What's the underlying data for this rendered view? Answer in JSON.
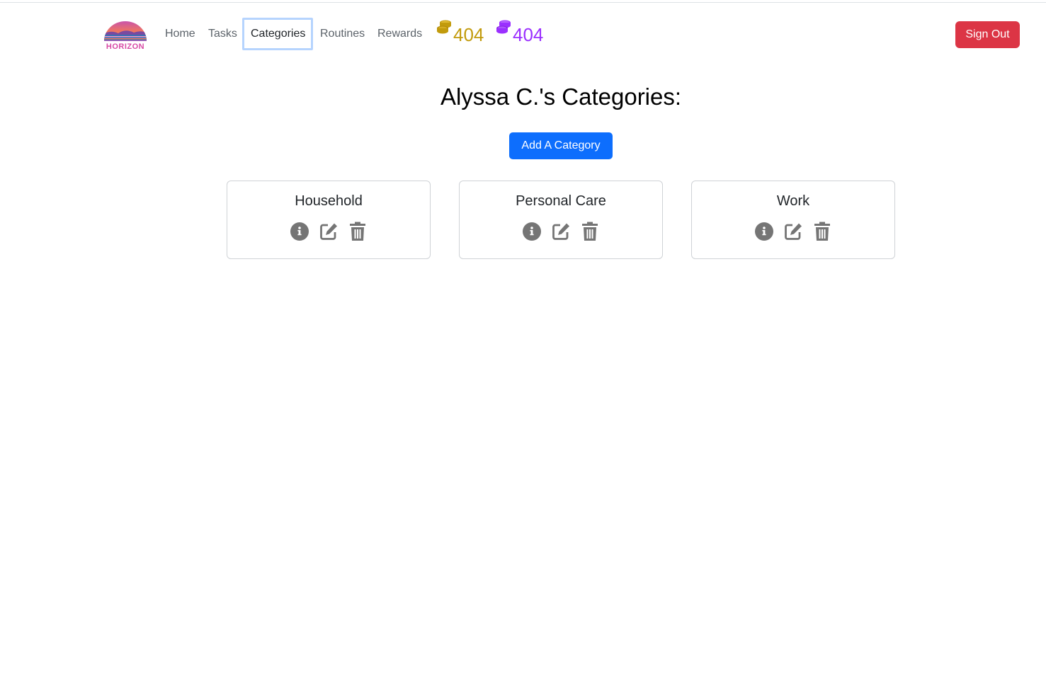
{
  "brand": {
    "logo_text": "HORIZON",
    "colors": {
      "sky_top": "#c44fb4",
      "sky_mid": "#f2785c",
      "sun": "#ffd27a",
      "sea": "#3a6fb0",
      "text": "#d84aa5"
    }
  },
  "nav": {
    "items": [
      {
        "label": "Home"
      },
      {
        "label": "Tasks"
      },
      {
        "label": "Categories",
        "active": true
      },
      {
        "label": "Routines"
      },
      {
        "label": "Rewards"
      }
    ],
    "gold_coins": {
      "icon": "gold-coins-icon",
      "count": "404",
      "color": "#c29b0c"
    },
    "purple_coins": {
      "icon": "purple-coins-icon",
      "count": "404",
      "color": "#9b30ff"
    },
    "sign_out_label": "Sign Out",
    "sign_out_color": "#dc3545"
  },
  "main": {
    "title": "Alyssa C.'s Categories:",
    "add_button_label": "Add A Category",
    "add_button_color": "#0d6efd",
    "categories": [
      {
        "name": "Household",
        "actions": [
          "info-icon",
          "edit-icon",
          "trash-icon"
        ]
      },
      {
        "name": "Personal Care",
        "actions": [
          "info-icon",
          "edit-icon",
          "trash-icon"
        ]
      },
      {
        "name": "Work",
        "actions": [
          "info-icon",
          "edit-icon",
          "trash-icon"
        ]
      }
    ],
    "icon_color": "#757575"
  }
}
